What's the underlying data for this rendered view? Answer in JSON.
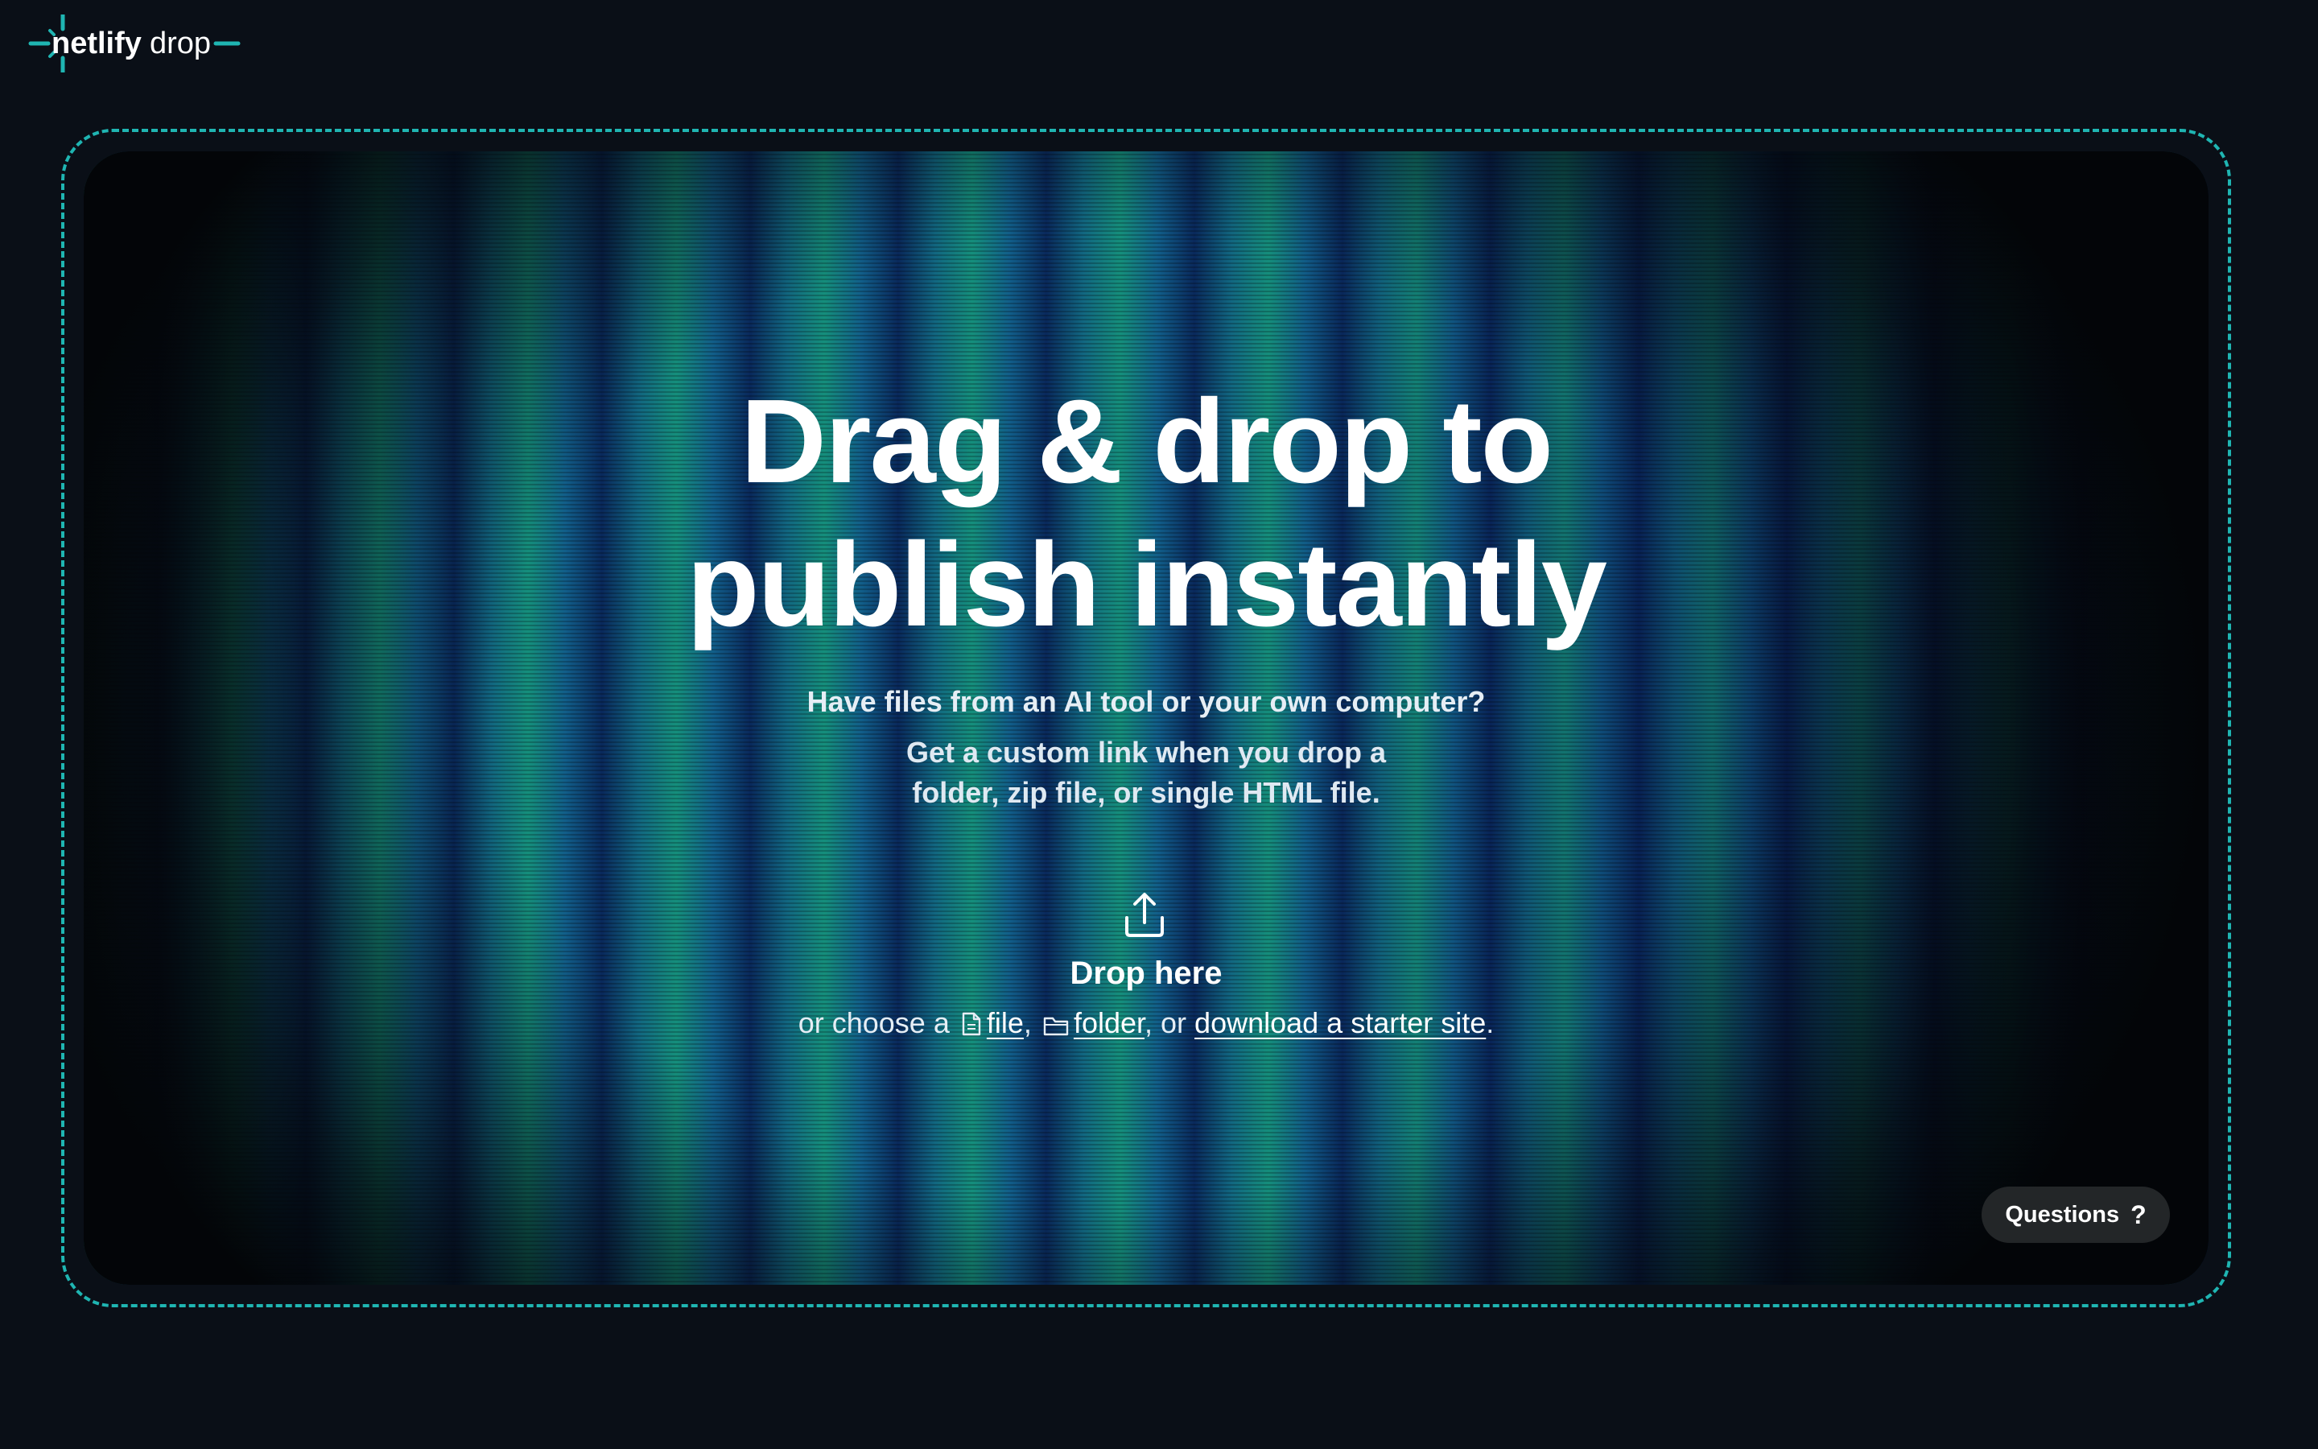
{
  "header": {
    "logo_netlify": "netlify",
    "logo_drop": "drop"
  },
  "hero": {
    "headline_line1": "Drag & drop to",
    "headline_line2": "publish instantly",
    "subhead": "Have files from an AI tool or your own computer?",
    "subtext_line1": "Get a custom link when you drop a",
    "subtext_line2": "folder, zip file, or single HTML file."
  },
  "dropzone": {
    "icon": "upload-icon",
    "title": "Drop here",
    "prefix": "or choose a",
    "file_link": "file",
    "sep1": ",",
    "folder_link": "folder",
    "sep2": ", or",
    "starter_link": "download a starter site",
    "suffix": "."
  },
  "help": {
    "questions_label": "Questions",
    "questions_icon": "?"
  },
  "colors": {
    "accent": "#1fb5b2",
    "background": "#0a0f17",
    "button_bg": "#232628"
  }
}
